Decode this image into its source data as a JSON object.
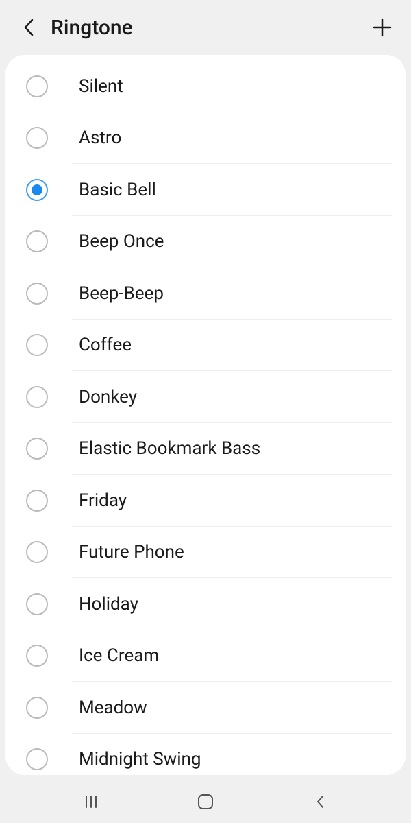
{
  "header": {
    "title": "Ringtone"
  },
  "ringtones": [
    {
      "label": "Silent",
      "selected": false
    },
    {
      "label": "Astro",
      "selected": false
    },
    {
      "label": "Basic Bell",
      "selected": true
    },
    {
      "label": "Beep Once",
      "selected": false
    },
    {
      "label": "Beep-Beep",
      "selected": false
    },
    {
      "label": "Coffee",
      "selected": false
    },
    {
      "label": "Donkey",
      "selected": false
    },
    {
      "label": "Elastic Bookmark Bass",
      "selected": false
    },
    {
      "label": "Friday",
      "selected": false
    },
    {
      "label": "Future Phone",
      "selected": false
    },
    {
      "label": "Holiday",
      "selected": false
    },
    {
      "label": "Ice Cream",
      "selected": false
    },
    {
      "label": "Meadow",
      "selected": false
    },
    {
      "label": "Midnight Swing",
      "selected": false
    }
  ]
}
